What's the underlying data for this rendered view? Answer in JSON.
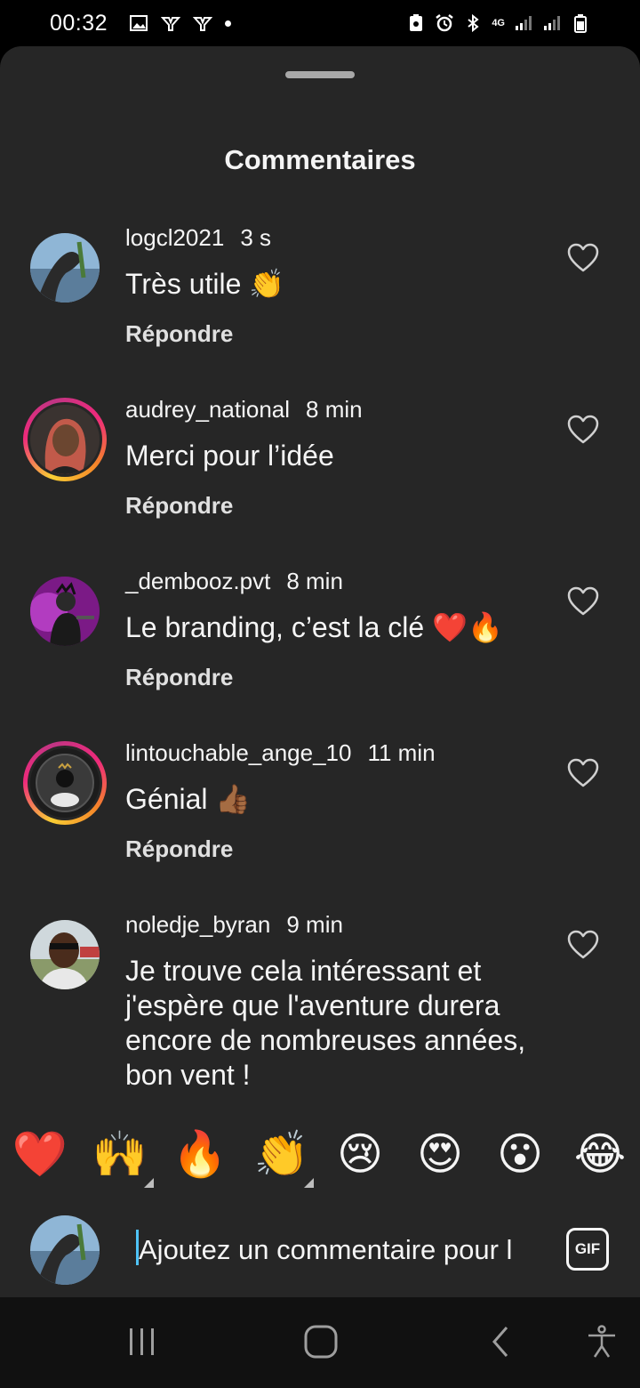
{
  "status_bar": {
    "time": "00:32",
    "network": "4G"
  },
  "sheet": {
    "title": "Commentaires"
  },
  "comments": [
    {
      "username": "logcl2021",
      "time": "3 s",
      "text": "Très utile 👏",
      "reply_label": "Répondre",
      "story_ring": false
    },
    {
      "username": "audrey_national",
      "time": "8 min",
      "text": "Merci pour l’idée",
      "reply_label": "Répondre",
      "story_ring": true
    },
    {
      "username": "_dembooz.pvt",
      "time": "8 min",
      "text": "Le branding, c’est la clé ❤️🔥",
      "reply_label": "Répondre",
      "story_ring": false
    },
    {
      "username": "lintouchable_ange_10",
      "time": "11 min",
      "text": "Génial 👍🏾",
      "reply_label": "Répondre",
      "story_ring": true
    },
    {
      "username": "noledje_byran",
      "time": "9 min",
      "text": "Je trouve cela intéressant et j'espère que l'aventure durera encore de nombreuses années, bon vent !",
      "reply_label": "",
      "story_ring": false
    }
  ],
  "quick_reactions": [
    "❤️",
    "🙌",
    "🔥",
    "👏",
    "😢",
    "😍",
    "😮",
    "😂"
  ],
  "composer": {
    "placeholder": "Ajoutez un commentaire pour l",
    "gif_label": "GIF"
  },
  "colors": {
    "sheet_bg": "#262626",
    "text": "#f5f5f5",
    "ring_gradient": [
      "#f9ce34",
      "#ee2a7b",
      "#c13584"
    ]
  },
  "icons": {
    "like": "heart-outline-icon",
    "nav_recent": "recent-apps-icon",
    "nav_home": "home-icon",
    "nav_back": "back-icon",
    "nav_accessibility": "accessibility-icon"
  }
}
